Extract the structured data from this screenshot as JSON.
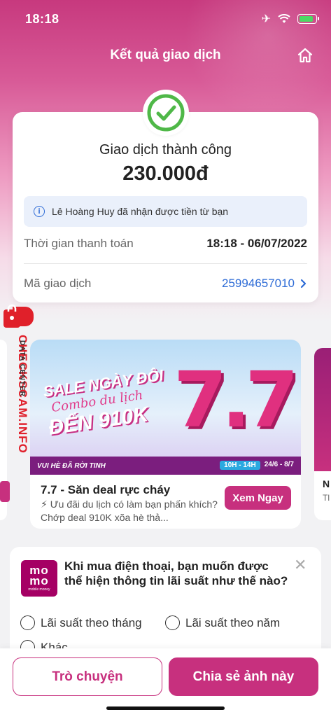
{
  "status_bar": {
    "time": "18:18"
  },
  "header": {
    "title": "Kết quả giao dịch"
  },
  "receipt": {
    "status": "Giao dịch thành công",
    "amount": "230.000đ",
    "info_message": "Lê Hoàng Huy đã nhận được tiền từ bạn",
    "payment_time_label": "Thời gian thanh toán",
    "payment_time_value": "18:18 - 06/07/2022",
    "transaction_id_label": "Mã giao dịch",
    "transaction_id_value": "25994657010"
  },
  "watermark": {
    "big": "CHECKSCAM.INFO",
    "small": "DATA CENTER"
  },
  "promo": {
    "banner_line1": "SALE NGÀY ĐÔI",
    "banner_line2": "Combo du lịch",
    "banner_line3": "ĐẾN 910K",
    "banner_big": "7.7",
    "banner_footer_left": "VUI HÈ ĐÃ RỜI TINH",
    "banner_time": "10H - 14H",
    "banner_dates": "24/6 - 8/7",
    "title": "7.7 - Săn deal rực cháy",
    "description": "⚡ Ưu đãi du lịch có làm bạn phấn khích? Chớp deal 910K xõa hè thả...",
    "cta": "Xem Ngay",
    "side_right_title": "N",
    "side_right_desc": "Tl bạ"
  },
  "survey": {
    "logo_top": "mo",
    "logo_bottom": "mo",
    "logo_caption": "mobile money",
    "question": "Khi mua điện thoại, bạn muốn được thể hiện thông tin lãi suất như thế nào?",
    "options": [
      "Lãi suất theo tháng",
      "Lãi suất theo năm",
      "Khác"
    ]
  },
  "actions": {
    "chat": "Trò chuyện",
    "share": "Chia sẻ ảnh này"
  },
  "colors": {
    "brand": "#c7307e",
    "success": "#4fb848",
    "link": "#2d6bd6"
  }
}
